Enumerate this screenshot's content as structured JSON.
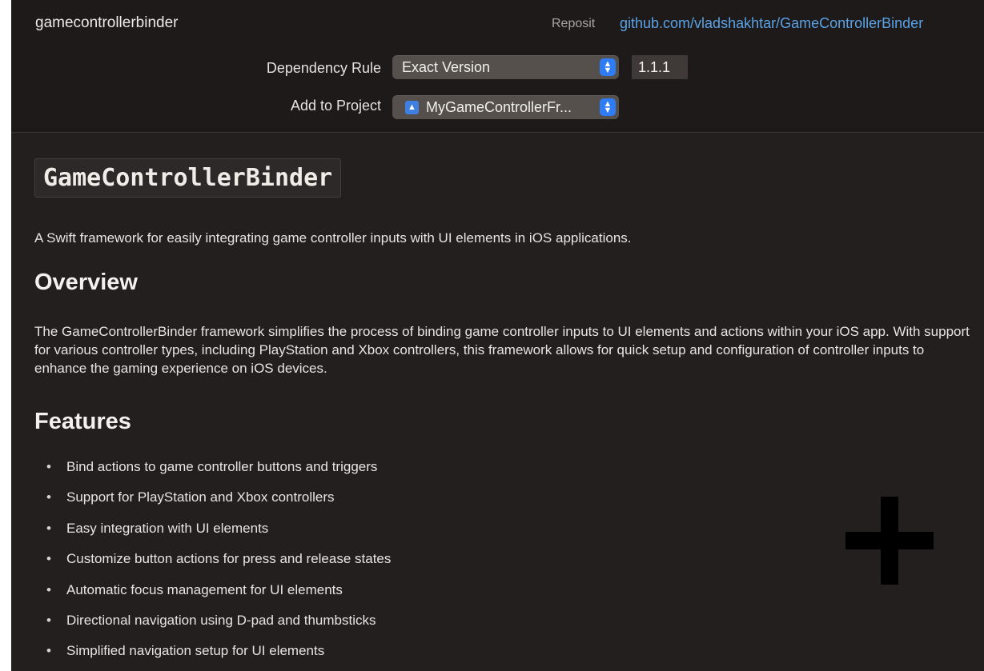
{
  "header": {
    "package_name": "gamecontrollerbinder",
    "repository_label": "Reposit",
    "repository_url": "github.com/vladshakhtar/GameControllerBinder",
    "dependency_rule_label": "Dependency Rule",
    "dependency_rule_value": "Exact Version",
    "version_value": "1.1.1",
    "add_to_project_label": "Add to Project",
    "add_to_project_value": "MyGameControllerFr..."
  },
  "readme": {
    "title": "GameControllerBinder",
    "intro": "A Swift framework for easily integrating game controller inputs with UI elements in iOS applications.",
    "overview_heading": "Overview",
    "overview_text": "The GameControllerBinder framework simplifies the process of binding game controller inputs to UI elements and actions within your iOS app. With support for various controller types, including PlayStation and Xbox controllers, this framework allows for quick setup and configuration of controller inputs to enhance the gaming experience on iOS devices.",
    "features_heading": "Features",
    "features": [
      "Bind actions to game controller buttons and triggers",
      "Support for PlayStation and Xbox controllers",
      "Easy integration with UI elements",
      "Customize button actions for press and release states",
      "Automatic focus management for UI elements",
      "Directional navigation using D-pad and thumbsticks",
      "Simplified navigation setup for UI elements"
    ]
  },
  "icons": {
    "popup_stepper": "up-down-chevron-icon",
    "project": "xcode-project-icon",
    "overlay": "crosshair-plus-icon"
  },
  "colors": {
    "background": "#231f1e",
    "header_background": "#1e1a1a",
    "link": "#5aa2e6",
    "accent": "#2e7cf6"
  }
}
